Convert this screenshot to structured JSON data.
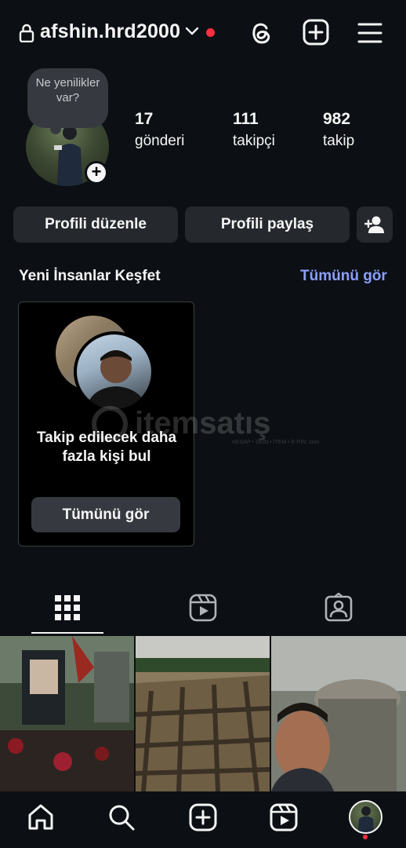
{
  "header": {
    "username": "afshin.hrd2000",
    "icons": [
      "lock-icon",
      "chevron-down-icon",
      "threads-icon",
      "new-post-icon",
      "menu-icon"
    ],
    "notification_dot_color": "#ff3040"
  },
  "profile": {
    "note_placeholder": "Ne yenilikler var?",
    "stats": [
      {
        "value": "17",
        "label": "gönderi"
      },
      {
        "value": "111",
        "label": "takipçi"
      },
      {
        "value": "982",
        "label": "takip"
      }
    ]
  },
  "actions": {
    "edit_profile": "Profili düzenle",
    "share_profile": "Profili paylaş"
  },
  "discover": {
    "title": "Yeni İnsanlar Keşfet",
    "see_all": "Tümünü gör",
    "card_text": "Takip edilecek daha fazla kişi bul",
    "card_button": "Tümünü gör"
  },
  "watermark": {
    "brand": "itemsatış",
    "tagline": "HESAP • SKIN • İTEM • E-PIN .com"
  },
  "tabs": [
    "grid-icon",
    "reels-icon",
    "tagged-icon"
  ],
  "bottom_nav": [
    "home-icon",
    "search-icon",
    "create-icon",
    "reels-icon",
    "profile-avatar"
  ],
  "colors": {
    "background": "#0c1014",
    "button": "#25292e",
    "link": "#8c9fff",
    "accent_red": "#ff3040"
  }
}
